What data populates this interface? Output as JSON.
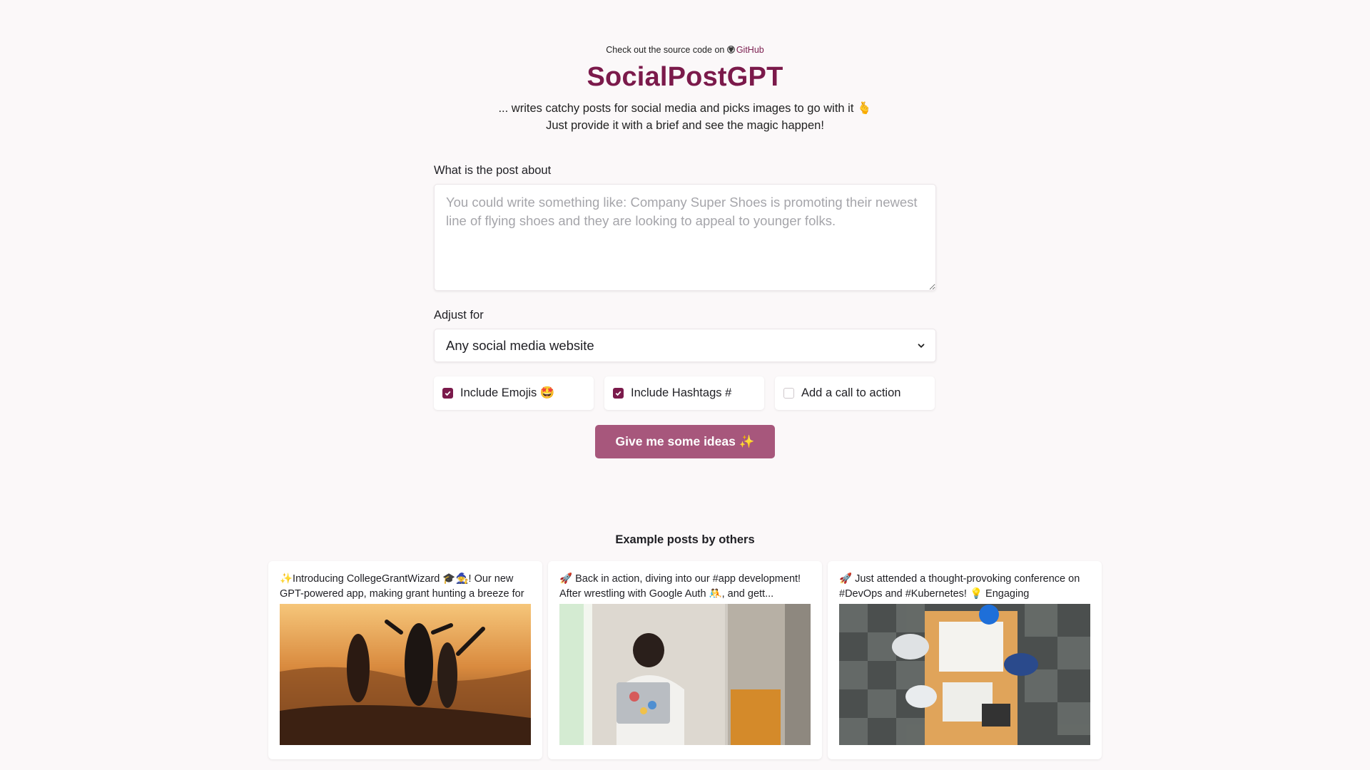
{
  "header": {
    "source_prefix": "Check out the source code on",
    "source_link": "GitHub",
    "title": "SocialPostGPT",
    "subtitle_line1": "... writes catchy posts for social media and picks images to go with it 🫰",
    "subtitle_line2": "Just provide it with a brief and see the magic happen!"
  },
  "form": {
    "about_label": "What is the post about",
    "about_placeholder": "You could write something like: Company Super Shoes is promoting their newest line of flying shoes and they are looking to appeal to younger folks.",
    "adjust_label": "Adjust for",
    "adjust_value": "Any social media website",
    "options": [
      {
        "label": "Include Emojis 🤩",
        "checked": true
      },
      {
        "label": "Include Hashtags #",
        "checked": true
      },
      {
        "label": "Add a call to action",
        "checked": false
      }
    ],
    "submit_label": "Give me some ideas ✨"
  },
  "examples": {
    "title": "Example posts by others",
    "cards": [
      {
        "text": "✨Introducing CollegeGrantWizard 🎓🧙! Our new GPT-powered app, making grant hunting a breeze for",
        "image": "friends-sunset-photo"
      },
      {
        "text": "🚀 Back in action, diving into our #app development! After wrestling with Google Auth 🤼, and gett...",
        "image": "frustrated-developer-photo"
      },
      {
        "text": "🚀 Just attended a thought-provoking conference on #DevOps and #Kubernetes! 💡 Engaging",
        "image": "team-meeting-table-photo"
      }
    ]
  },
  "colors": {
    "brand": "#7b1a4b",
    "button": "#a7577c",
    "background": "#fbf8f9"
  }
}
